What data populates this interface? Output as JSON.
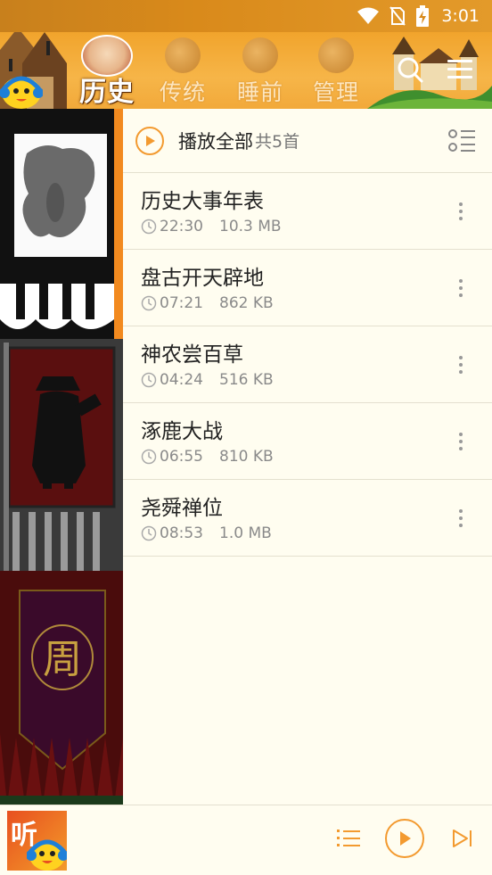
{
  "status_bar": {
    "time": "3:01"
  },
  "header": {
    "tabs": [
      {
        "label": "历史",
        "active": true
      },
      {
        "label": "传统",
        "active": false
      },
      {
        "label": "睡前",
        "active": false
      },
      {
        "label": "管理",
        "active": false
      }
    ],
    "search_icon": "search-icon",
    "menu_icon": "menu-icon"
  },
  "playlist": {
    "play_all_label": "播放全部",
    "count_label": "共5首",
    "tracks": [
      {
        "title": "历史大事年表",
        "duration": "22:30",
        "size": "10.3 MB"
      },
      {
        "title": "盘古开天辟地",
        "duration": "07:21",
        "size": "862 KB"
      },
      {
        "title": "神农尝百草",
        "duration": "04:24",
        "size": "516 KB"
      },
      {
        "title": "涿鹿大战",
        "duration": "06:55",
        "size": "810 KB"
      },
      {
        "title": "尧舜禅位",
        "duration": "08:53",
        "size": "1.0 MB"
      }
    ]
  },
  "banner": {
    "emblem_text": "周"
  },
  "player": {
    "cover_text": "听"
  },
  "colors": {
    "accent": "#f39a2f",
    "header": "#f1a42c",
    "background": "#fffdf0"
  }
}
